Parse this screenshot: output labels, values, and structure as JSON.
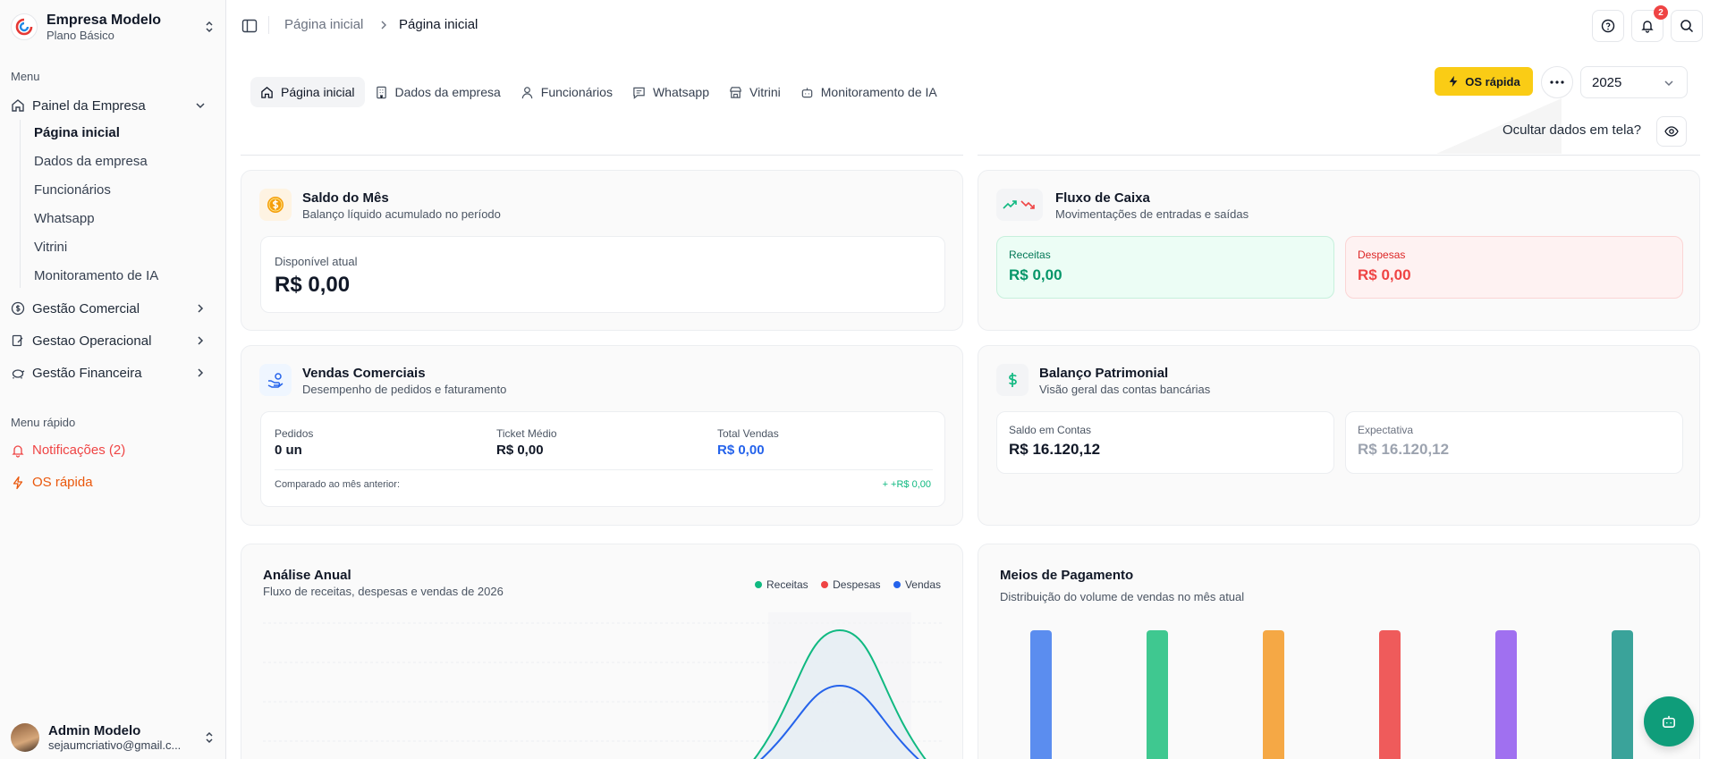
{
  "company": {
    "name": "Empresa Modelo",
    "plan": "Plano Básico"
  },
  "sidebar": {
    "menu_label": "Menu",
    "painel": {
      "label": "Painel da Empresa"
    },
    "sub_items": [
      "Página inicial",
      "Dados da empresa",
      "Funcionários",
      "Whatsapp",
      "Vitrini",
      "Monitoramento de IA"
    ],
    "groups": [
      "Gestão Comercial",
      "Gestao Operacional",
      "Gestão Financeira"
    ],
    "quick_label": "Menu rápido",
    "quick_notifications": "Notificações (2)",
    "quick_os": "OS rápida"
  },
  "user": {
    "name": "Admin Modelo",
    "email": "sejaumcriativo@gmail.c..."
  },
  "breadcrumb": {
    "first": "Página inicial",
    "current": "Página inicial"
  },
  "header": {
    "notification_count": "2"
  },
  "tabs": [
    "Página inicial",
    "Dados da empresa",
    "Funcionários",
    "Whatsapp",
    "Vitrini",
    "Monitoramento de IA"
  ],
  "actions": {
    "os_rapida": "OS rápida",
    "year": "2025",
    "hide_label": "Ocultar dados em tela?"
  },
  "saldo": {
    "title": "Saldo do Mês",
    "subtitle": "Balanço líquido acumulado no período",
    "label": "Disponível atual",
    "value": "R$ 0,00"
  },
  "fluxo": {
    "title": "Fluxo de Caixa",
    "subtitle": "Movimentações de entradas e saídas",
    "receitas_label": "Receitas",
    "receitas_value": "R$ 0,00",
    "despesas_label": "Despesas",
    "despesas_value": "R$ 0,00"
  },
  "vendas": {
    "title": "Vendas Comerciais",
    "subtitle": "Desempenho de pedidos e faturamento",
    "pedidos_label": "Pedidos",
    "pedidos_value": "0 un",
    "ticket_label": "Ticket Médio",
    "ticket_value": "R$ 0,00",
    "total_label": "Total Vendas",
    "total_value": "R$ 0,00",
    "compare_label": "Comparado ao mês anterior:",
    "compare_value": "+ +R$ 0,00"
  },
  "balanco": {
    "title": "Balanço Patrimonial",
    "subtitle": "Visão geral das contas bancárias",
    "saldo_label": "Saldo em Contas",
    "saldo_value": "R$ 16.120,12",
    "expect_label": "Expectativa",
    "expect_value": "R$ 16.120,12"
  },
  "analise": {
    "title": "Análise Anual",
    "subtitle": "Fluxo de receitas, despesas e vendas de 2026",
    "legend": [
      "Receitas",
      "Despesas",
      "Vendas"
    ]
  },
  "meios": {
    "title": "Meios de Pagamento",
    "subtitle": "Distribuição do volume de vendas no mês atual"
  },
  "colors": {
    "accent_yellow": "#facc15",
    "green": "#10b981",
    "red": "#ef4444",
    "blue": "#2563eb",
    "teal_fab": "#0f9d7a"
  },
  "chart_data": [
    {
      "type": "area",
      "title": "Análise Anual",
      "series": [
        {
          "name": "Receitas",
          "color": "#10b981",
          "peak_category_index": 9
        },
        {
          "name": "Despesas",
          "color": "#ef4444",
          "peak_category_index": 9
        },
        {
          "name": "Vendas",
          "color": "#2563eb",
          "peak_category_index": 9
        }
      ],
      "grid": true,
      "legend": "top-right"
    },
    {
      "type": "bar",
      "title": "Meios de Pagamento",
      "bar_colors": [
        "#5b8def",
        "#3fc890",
        "#f5a845",
        "#ef5b5b",
        "#a070f0",
        "#3aa39a"
      ],
      "values_equal": true
    }
  ]
}
